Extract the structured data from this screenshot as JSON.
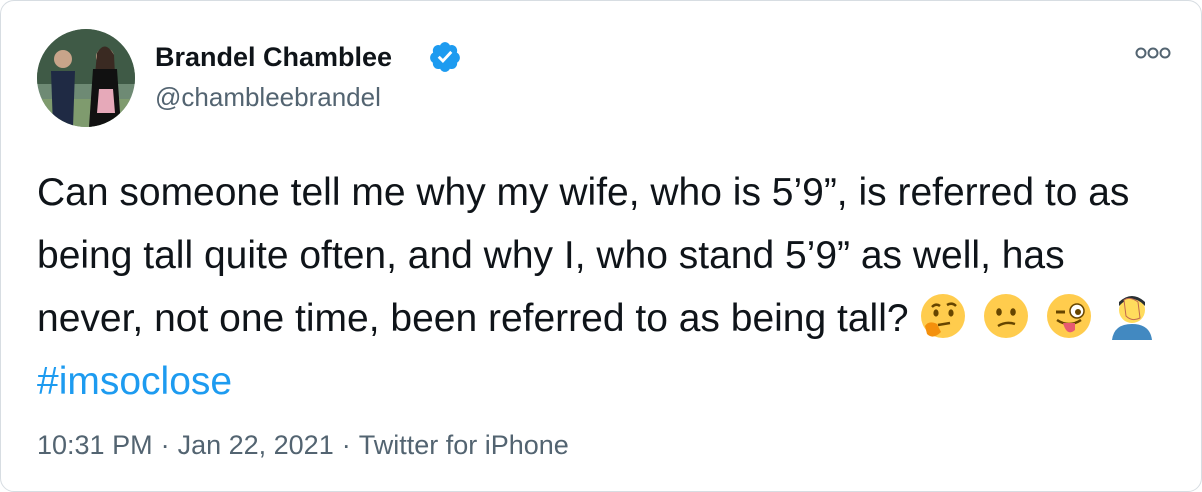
{
  "author": {
    "name": "Brandel Chamblee",
    "handle": "@chambleebrandel",
    "verified": true,
    "verified_color": "#1d9bf0"
  },
  "tweet": {
    "text": "Can someone tell me why my wife, who is 5’9”, is referred to as being tall quite often, and why I, who stand 5’9” as well, has never, not one time, been referred to as being tall?",
    "emojis": [
      "thinking-face-icon",
      "confused-face-icon",
      "winking-tongue-face-icon",
      "facepalm-icon"
    ],
    "hashtag": "#imsoclose",
    "hashtag_color": "#1d9bf0"
  },
  "meta": {
    "time": "10:31 PM",
    "separator": "·",
    "date": "Jan 22, 2021",
    "source": "Twitter for iPhone"
  },
  "icons": {
    "more": "more-options-icon",
    "verified": "verified-badge-icon"
  }
}
